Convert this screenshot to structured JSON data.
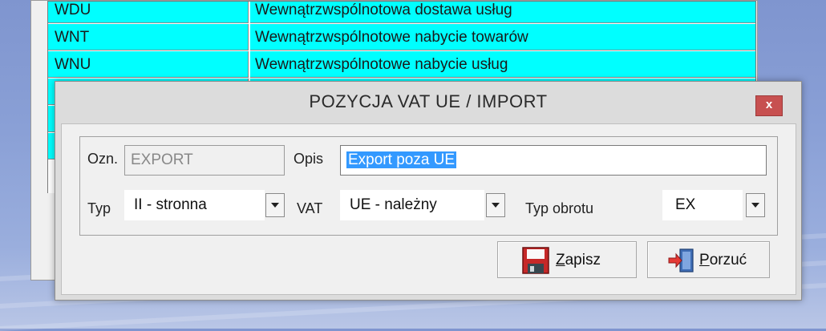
{
  "list": {
    "rows": [
      {
        "code": "WDU",
        "desc": "Wewnątrzwspólnotowa dostawa usług"
      },
      {
        "code": "WNT",
        "desc": "Wewnątrzwspólnotowe nabycie towarów"
      },
      {
        "code": "WNU",
        "desc": "Wewnątrzwspólnotowe nabycie usług"
      }
    ]
  },
  "dialog": {
    "title": "POZYCJA VAT UE / IMPORT",
    "close_glyph": "x",
    "ozn_label": "Ozn.",
    "ozn_value": "EXPORT",
    "opis_label": "Opis",
    "opis_value": "Export poza UE",
    "typ_label": "Typ",
    "typ_value": "II - stronna",
    "vat_label": "VAT",
    "vat_value": "UE - należny",
    "typ_obrotu_label": "Typ obrotu",
    "typ_obrotu_value": "EX",
    "save_underlined": "Z",
    "save_rest": "apisz",
    "cancel_underlined": "P",
    "cancel_rest": "orzuć"
  },
  "colors": {
    "row_highlight": "#00ffff",
    "close_button": "#c75050",
    "selection": "#3399ff"
  },
  "icons": {
    "save": "floppy-disk-icon",
    "cancel": "exit-door-icon"
  }
}
